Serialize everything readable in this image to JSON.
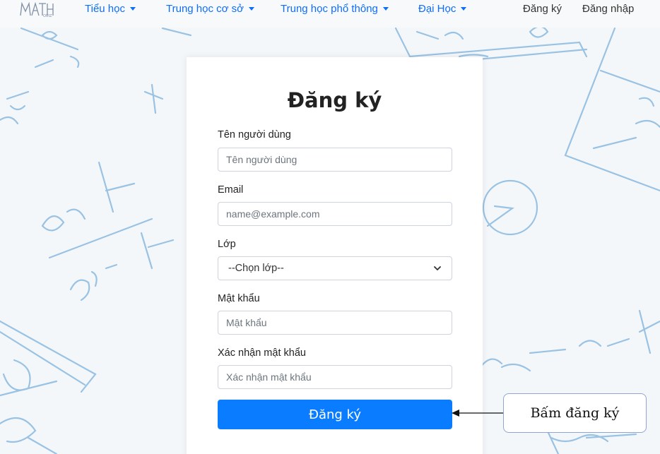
{
  "navbar": {
    "logo_text": "MATH QUIZ",
    "items": [
      {
        "label": "Tiểu học"
      },
      {
        "label": "Trung học cơ sở"
      },
      {
        "label": "Trung học phổ thông"
      },
      {
        "label": "Đại Học"
      }
    ],
    "register": "Đăng ký",
    "login": "Đăng nhập"
  },
  "form": {
    "title": "Đăng ký",
    "username": {
      "label": "Tên người dùng",
      "placeholder": "Tên người dùng"
    },
    "email": {
      "label": "Email",
      "placeholder": "name@example.com"
    },
    "grade": {
      "label": "Lớp",
      "selected": "--Chọn lớp--"
    },
    "password": {
      "label": "Mật khẩu",
      "placeholder": "Mật khẩu"
    },
    "confirm": {
      "label": "Xác nhận mật khẩu",
      "placeholder": "Xác nhận mật khẩu"
    },
    "submit": "Đăng ký"
  },
  "annotation": {
    "callout": "Bấm đăng ký"
  },
  "colors": {
    "primary": "#0a7cff",
    "nav_link": "#0d6efd",
    "doodle": "#7fb0dc"
  }
}
